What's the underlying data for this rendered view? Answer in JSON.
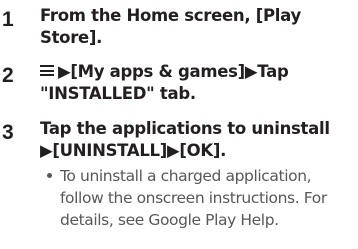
{
  "steps": [
    {
      "number": "1",
      "lines": [
        "From the Home screen, [Play",
        "Store]."
      ]
    },
    {
      "number": "2",
      "icon": "menu-icon",
      "lines": [
        "▶[My apps & games]▶Tap",
        "\"INSTALLED\" tab."
      ]
    },
    {
      "number": "3",
      "lines": [
        "Tap the applications to uninstall",
        "▶[UNINSTALL]▶[OK]."
      ]
    }
  ],
  "note": {
    "lines": [
      "To uninstall a charged application,",
      "follow the onscreen instructions. For",
      "details, see Google Play Help."
    ]
  }
}
